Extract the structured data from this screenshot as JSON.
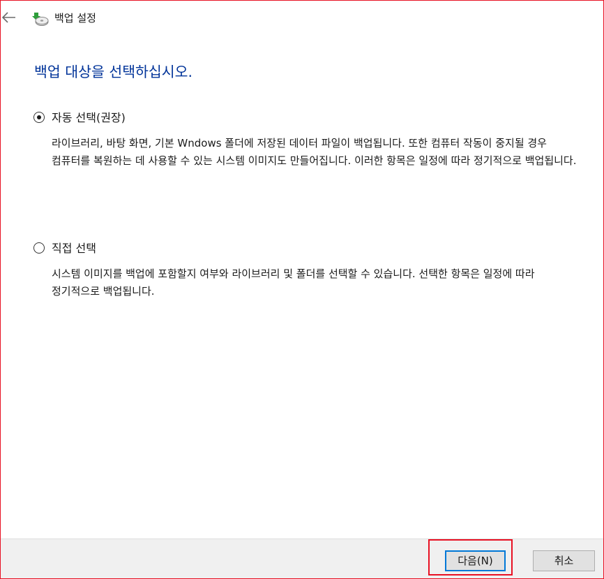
{
  "window": {
    "title": "백업 설정"
  },
  "icons": {
    "back": "back-arrow-icon",
    "app": "backup-drive-icon"
  },
  "main": {
    "heading": "백업 대상을 선택하십시오."
  },
  "options": [
    {
      "label": "자동 선택(권장)",
      "selected": true,
      "description": "라이브러리, 바탕 화면, 기본 Wndows 폴더에 저장된 데이터 파일이 백업됩니다. 또한 컴퓨터 작동이 중지될 경우 컴퓨터를 복원하는 데 사용할 수 있는 시스템 이미지도 만들어집니다. 이러한 항목은 일정에 따라 정기적으로 백업됩니다."
    },
    {
      "label": "직접 선택",
      "selected": false,
      "description": "시스템 이미지를 백업에 포함할지 여부와 라이브러리 및 폴더를 선택할 수 있습니다. 선택한 항목은 일정에 따라 정기적으로 백업됩니다."
    }
  ],
  "footer": {
    "next_label": "다음(N)",
    "cancel_label": "취소"
  },
  "colors": {
    "heading": "#003399",
    "highlight": "#e81123",
    "footer_bg": "#f0f0f0",
    "button_focus": "#0078d7"
  }
}
